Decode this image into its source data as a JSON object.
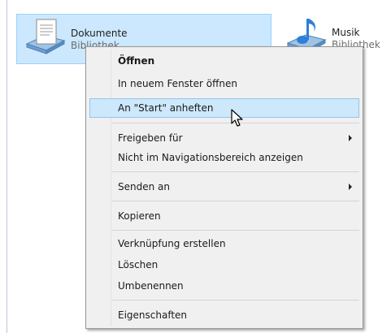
{
  "libraries": [
    {
      "name": "Dokumente",
      "type": "Bibliothek",
      "icon": "documents-library-icon"
    },
    {
      "name": "Musik",
      "type": "Bibliothek",
      "icon": "music-library-icon"
    }
  ],
  "context_menu": {
    "items": [
      {
        "label": "Öffnen"
      },
      {
        "label": "In neuem Fenster öffnen"
      },
      {
        "label": "An \"Start\" anheften"
      },
      {
        "label": "Freigeben für"
      },
      {
        "label": "Nicht im Navigationsbereich anzeigen"
      },
      {
        "label": "Senden an"
      },
      {
        "label": "Kopieren"
      },
      {
        "label": "Verknüpfung erstellen"
      },
      {
        "label": "Löschen"
      },
      {
        "label": "Umbenennen"
      },
      {
        "label": "Eigenschaften"
      }
    ]
  },
  "colors": {
    "selection": "#cce8ff",
    "menu_background": "#f0f0f0",
    "menu_hover": "#cde8fb"
  }
}
